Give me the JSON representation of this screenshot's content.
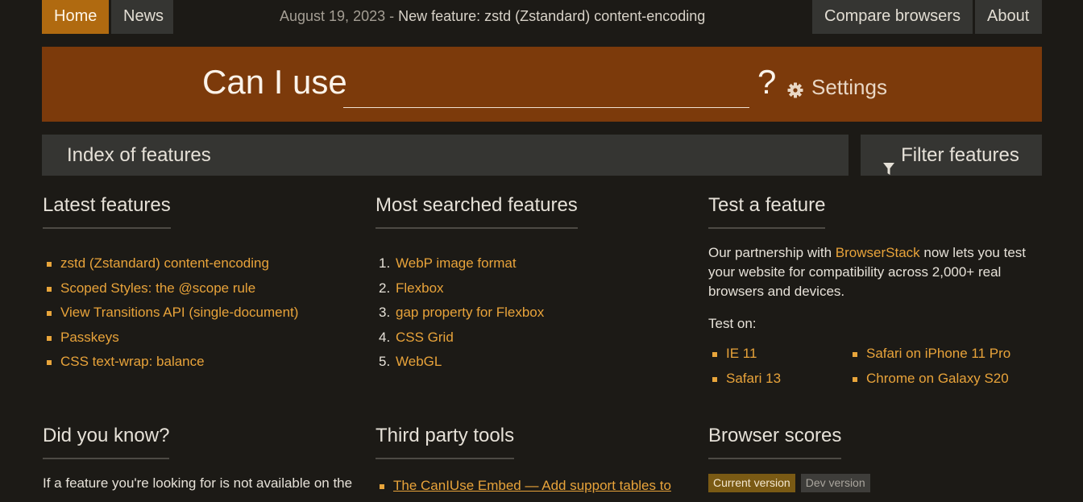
{
  "nav": {
    "home": "Home",
    "news": "News",
    "compare": "Compare browsers",
    "about": "About"
  },
  "newsline": {
    "date": "August 19, 2023",
    "separator": " - ",
    "headline": "New feature: zstd (Zstandard) content-encoding"
  },
  "search": {
    "prefix": "Can I use",
    "value": "",
    "suffix": "?",
    "settings_label": "Settings",
    "settings_icon": "gear-icon"
  },
  "index": {
    "title": "Index of features",
    "filter_label": "Filter features",
    "filter_icon": "funnel-icon"
  },
  "latest": {
    "heading": "Latest features",
    "items": [
      "zstd (Zstandard) content-encoding",
      "Scoped Styles: the @scope rule",
      "View Transitions API (single-document)",
      "Passkeys",
      "CSS text-wrap: balance"
    ]
  },
  "searched": {
    "heading": "Most searched features",
    "items": [
      {
        "num": "1.",
        "label": "WebP image format"
      },
      {
        "num": "2.",
        "label": "Flexbox"
      },
      {
        "num": "3.",
        "label": "gap property for Flexbox"
      },
      {
        "num": "4.",
        "label": "CSS Grid"
      },
      {
        "num": "5.",
        "label": "WebGL"
      }
    ]
  },
  "test": {
    "heading": "Test a feature",
    "intro_before": "Our partnership with ",
    "intro_link": "BrowserStack",
    "intro_after": " now lets you test your website for compatibility across 2,000+ real browsers and devices.",
    "test_on": "Test on:",
    "col1": [
      "IE 11",
      "Safari 13"
    ],
    "col2": [
      "Safari on iPhone 11 Pro",
      "Chrome on Galaxy S20"
    ]
  },
  "dyk": {
    "heading": "Did you know?",
    "text": "If a feature you're looking for is not available on the"
  },
  "tools": {
    "heading": "Third party tools",
    "first_item": "The CanIUse Embed — Add support tables to"
  },
  "scores": {
    "heading": "Browser scores",
    "tab_current": "Current version",
    "tab_dev": "Dev version"
  },
  "colors": {
    "accent": "#b06a10",
    "banner": "#7c3a0b",
    "link": "#e8a33a",
    "background": "#1c1a16"
  }
}
